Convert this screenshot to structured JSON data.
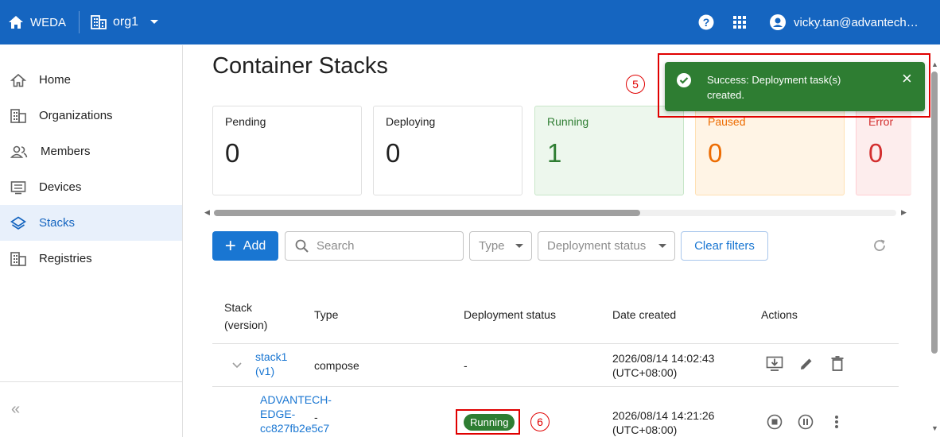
{
  "topbar": {
    "brand_label": "WEDA",
    "org_label": "org1",
    "user_label": "vicky.tan@advantech.com",
    "icons": [
      "home-icon",
      "building-icon",
      "dropdown-caret-icon",
      "help-icon",
      "apps-grid-icon",
      "account-icon"
    ]
  },
  "sidebar": {
    "items": [
      {
        "label": "Home",
        "icon": "home-outline-icon"
      },
      {
        "label": "Organizations",
        "icon": "building-icon"
      },
      {
        "label": "Members",
        "icon": "members-icon"
      },
      {
        "label": "Devices",
        "icon": "device-icon"
      },
      {
        "label": "Stacks",
        "icon": "layers-icon",
        "active": true
      },
      {
        "label": "Registries",
        "icon": "building-icon"
      }
    ],
    "collapse_label": "«"
  },
  "page": {
    "title": "Container Stacks"
  },
  "cards": [
    {
      "label": "Pending",
      "value": "0",
      "color": "#212121",
      "bg": "#ffffff"
    },
    {
      "label": "Deploying",
      "value": "0",
      "color": "#212121",
      "bg": "#ffffff"
    },
    {
      "label": "Running",
      "value": "1",
      "color": "#2e7d32",
      "bg": "#edf7ed"
    },
    {
      "label": "Paused",
      "value": "0",
      "color": "#ed6c02",
      "bg": "#fff4e5"
    },
    {
      "label": "Error",
      "value": "0",
      "color": "#d32f2f",
      "bg": "#fdeded"
    }
  ],
  "toolbar": {
    "add_label": "Add",
    "search_placeholder": "Search",
    "type_label": "Type",
    "status_label": "Deployment status",
    "clear_label": "Clear filters"
  },
  "table": {
    "headers": {
      "stack_line1": "Stack",
      "stack_line2": "(version)",
      "type": "Type",
      "status": "Deployment status",
      "date": "Date created",
      "actions": "Actions"
    },
    "row1": {
      "name": "stack1",
      "version": "(v1)",
      "type": "compose",
      "status": "-",
      "date": "2026/08/14 14:02:43",
      "tz": "(UTC+08:00)"
    },
    "row2": {
      "device_line1": "ADVANTECH-",
      "device_line2": "EDGE-",
      "device_line3": "cc827fb2e5c7",
      "type": "-",
      "status": "Running",
      "date": "2026/08/14 14:21:26",
      "tz": "(UTC+08:00)"
    }
  },
  "toast": {
    "message": "Success: Deployment task(s) created.",
    "close": "×"
  },
  "annotations": {
    "step5": "5",
    "step6": "6"
  },
  "colors": {
    "primary": "#1565c0",
    "success": "#2e7d32",
    "annotation": "#e00000"
  }
}
